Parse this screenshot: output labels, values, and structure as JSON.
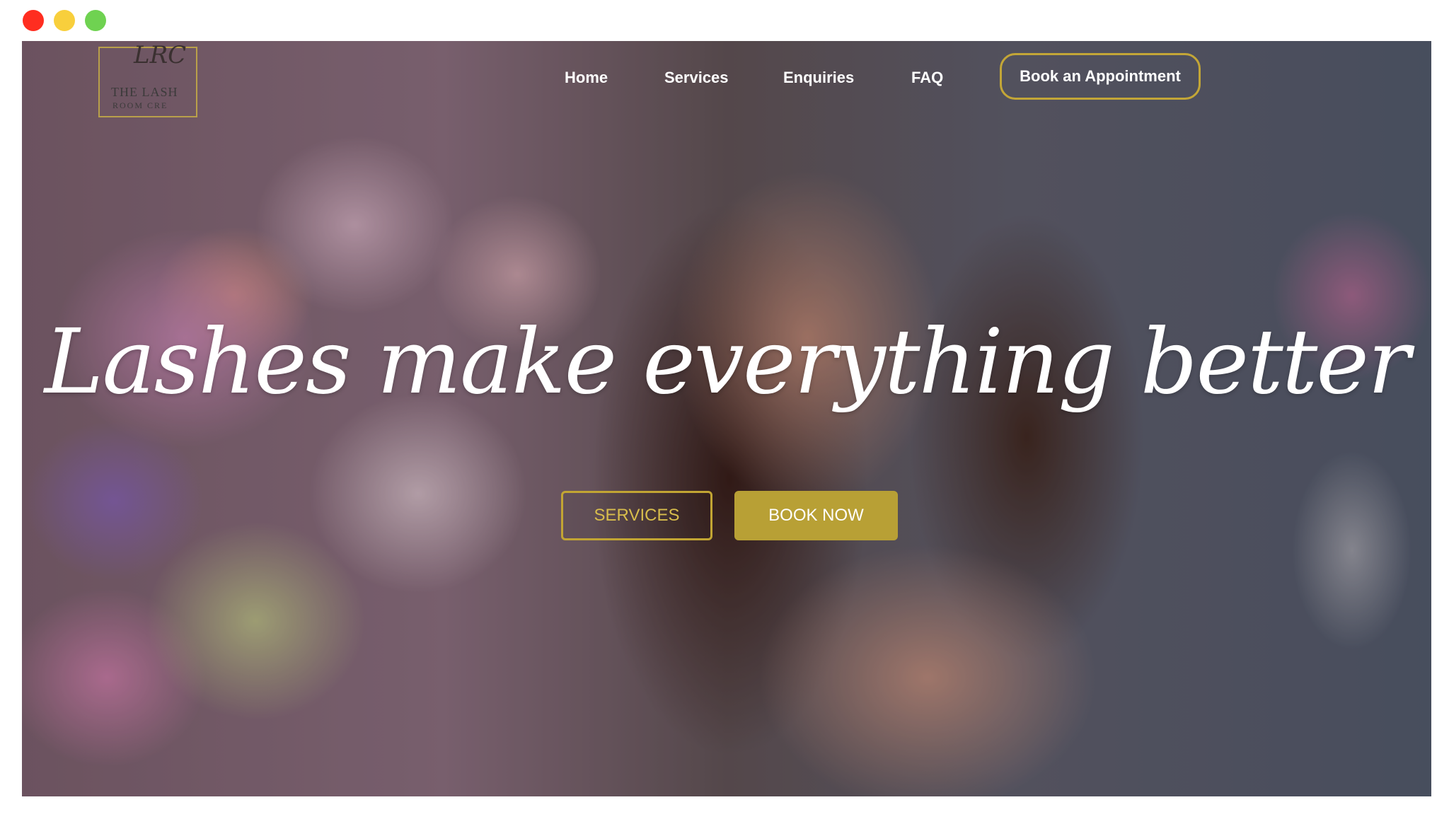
{
  "window": {
    "controls": [
      {
        "name": "close",
        "color": "#ff2d20"
      },
      {
        "name": "minimize",
        "color": "#f8cf3c"
      },
      {
        "name": "maximize",
        "color": "#6fd251"
      }
    ]
  },
  "brand": {
    "monogram": "LRC",
    "line1": "THE LASH",
    "line2": "ROOM CRE",
    "border_color": "#b9a04a"
  },
  "nav": {
    "items": [
      {
        "label": "Home"
      },
      {
        "label": "Services"
      },
      {
        "label": "Enquiries"
      },
      {
        "label": "FAQ"
      }
    ],
    "cta_label": "Book an Appointment",
    "accent": "#c3a637"
  },
  "hero": {
    "headline": "Lashes make everything better",
    "services_label": "SERVICES",
    "book_label": "BOOK NOW",
    "book_bg": "#b8a035"
  }
}
